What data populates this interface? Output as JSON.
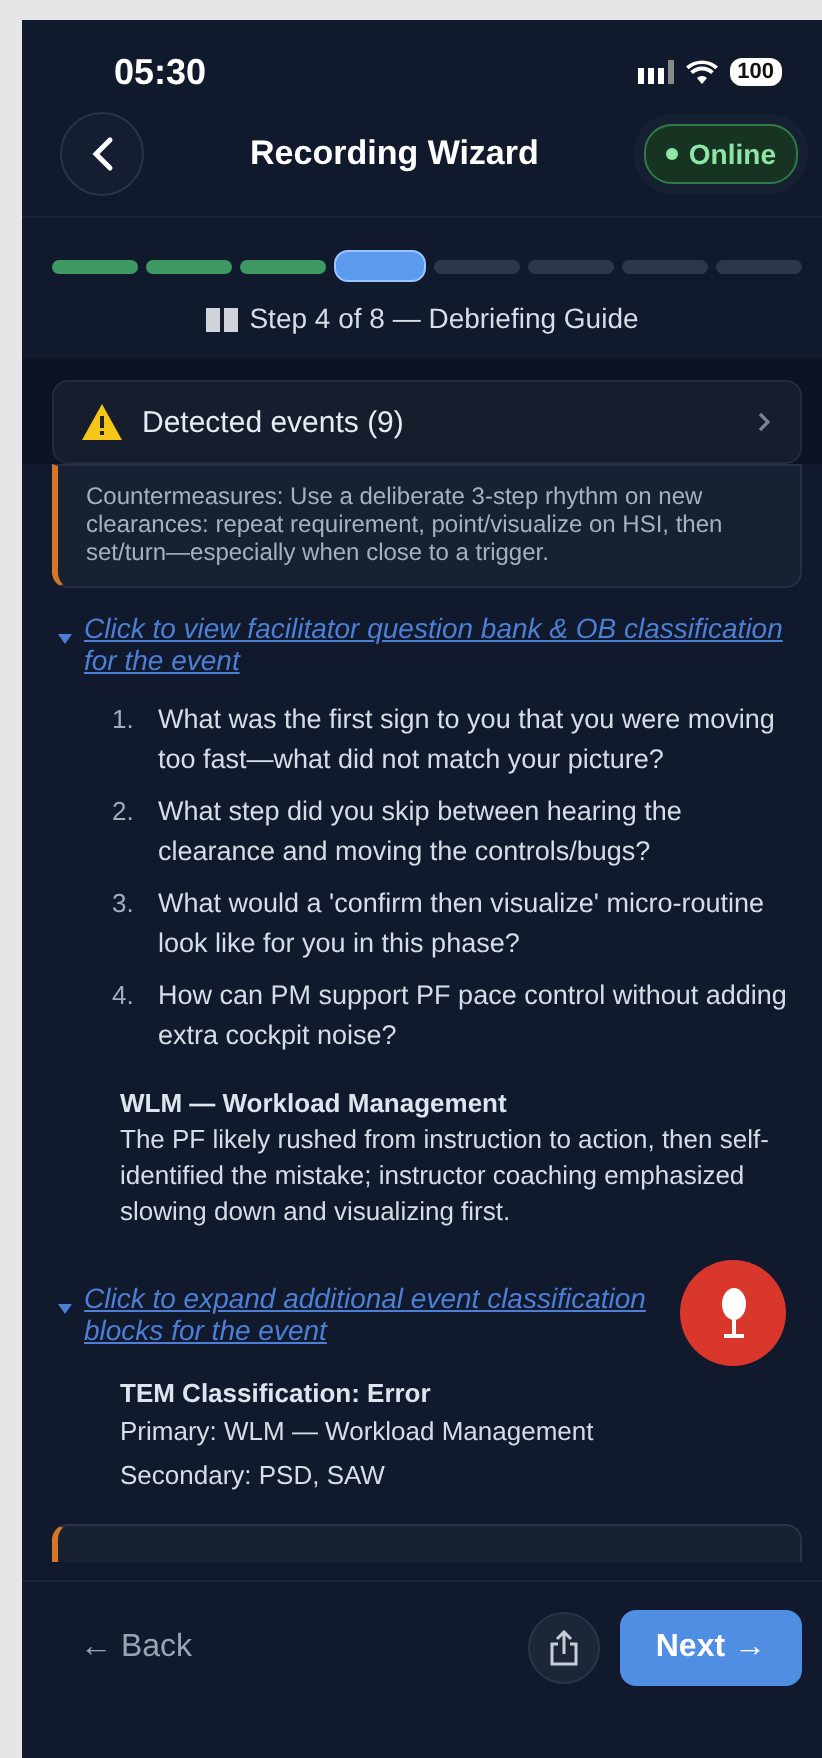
{
  "status_bar": {
    "time": "05:30",
    "battery": "100"
  },
  "header": {
    "title": "Recording Wizard",
    "status": {
      "label": "Online",
      "online": true
    }
  },
  "progress": {
    "segments": [
      {
        "kind": "done"
      },
      {
        "kind": "done"
      },
      {
        "kind": "done"
      },
      {
        "kind": "current"
      },
      {
        "kind": "pending"
      },
      {
        "kind": "pending"
      },
      {
        "kind": "pending"
      },
      {
        "kind": "pending"
      }
    ],
    "caption": "Step 4 of 8 — Debriefing Guide"
  },
  "events_bar": {
    "label": "Detected events (9)",
    "expanded": false
  },
  "countermeasures": "Countermeasures: Use a deliberate 3-step rhythm on new clearances: repeat requirement, point/visualize on HSI, then set/turn—especially when close to a trigger.",
  "question_section": {
    "link": "Click to view facilitator question bank & OB classification for the event",
    "expanded": true,
    "questions": [
      {
        "number": "1.",
        "text": "What was the first sign to you that you were moving too fast—what did not match your picture?"
      },
      {
        "number": "2.",
        "text": "What step did you skip between hearing the clearance and moving the controls/bugs?"
      },
      {
        "number": "3.",
        "text": "What would a 'confirm then visualize' micro-routine look like for you in this phase?"
      },
      {
        "number": "4.",
        "text": "How can PM support PF pace control without adding extra cockpit noise?"
      }
    ],
    "ob_title": "WLM — Workload Management",
    "ob_text": "The PF likely rushed from instruction to action, then self-identified the mistake; instructor coaching emphasized slowing down and visualizing first."
  },
  "classification_section": {
    "link": "Click to expand additional event classification blocks for the event",
    "expanded": true,
    "title": "TEM Classification: Error",
    "lines": [
      "Primary: WLM — Workload Management",
      "Secondary: PSD, SAW"
    ]
  },
  "footer": {
    "back": "← Back",
    "next": "Next →"
  }
}
